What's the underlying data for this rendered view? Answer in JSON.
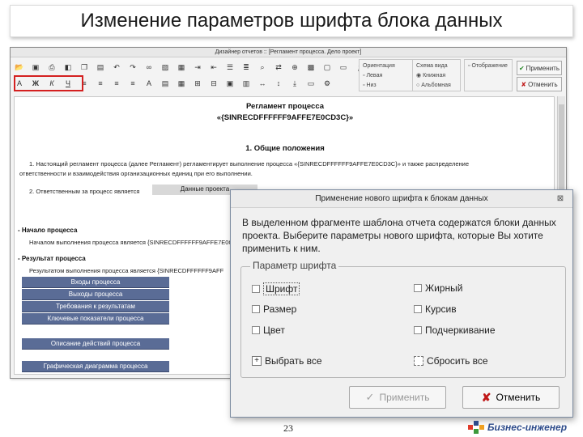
{
  "slide": {
    "title": "Изменение параметров шрифта блока данных",
    "page_number": "23",
    "brand": "Бизнес-инженер"
  },
  "editor": {
    "window_title": "Дизайнер отчетов :: [Регламент процесса. Дело проект]",
    "toolbar_row1_icons": [
      "open-icon",
      "save-icon",
      "print-icon",
      "preview-icon",
      "copy-icon",
      "paste-icon",
      "undo-icon",
      "redo-icon",
      "link-icon",
      "image-icon",
      "table-icon",
      "indent-icon",
      "outdent-icon",
      "list-icon",
      "numbered-list-icon",
      "find-icon",
      "replace-icon",
      "zoom-icon",
      "grid-icon",
      "frame-icon",
      "field-icon",
      "variable-icon"
    ],
    "toolbar_row2_fmt": [
      "А",
      "Ж",
      "К",
      "Ч"
    ],
    "groups": {
      "orientation": [
        "Ориентация",
        "Левая",
        "Низ"
      ],
      "scheme": [
        "Схема вида",
        "Книжная",
        "Альбомная"
      ],
      "display": [
        "Отображение"
      ]
    },
    "apply_label": "Применить",
    "cancel_label": "Отменить"
  },
  "document": {
    "title1": "Регламент процесса",
    "title2": "«{SINRECDFFFFFF9AFFE7E0CD3C}»",
    "section1": "1. Общие положения",
    "para1a": "1. Настоящий регламент процесса (далее Регламент) регламентирует выполнение процесса «{SINRECDFFFFFF9AFFE7E0CD3C}» и также распределение",
    "para1b": "ответственности и взаимодействия организационных единиц при его выполнении.",
    "para2": "2. Ответственным за процесс является",
    "data_field": "Данные проекта",
    "start_header": "- Начало процесса",
    "start_text": "Началом выполнения процесса является {SINRECDFFFFFF9AFFE7E0CD3C}",
    "result_header": "- Результат процесса",
    "result_text": "Результатом выполнения процесса является {SINRECDFFFFFF9AFF",
    "blocks": [
      "Входы процесса",
      "Выходы процесса",
      "Требования к результатам",
      "Ключевые показатели процесса"
    ],
    "block_actions": "Описание действий процесса",
    "block_diagram": "Графическая диаграмма процесса"
  },
  "dialog": {
    "title": "Применение нового шрифта к блокам данных",
    "message": "В выделенном фрагменте шаблона отчета содержатся блоки данных проекта. Выберите параметры нового шрифта, которые Вы хотите применить к ним.",
    "legend": "Параметр шрифта",
    "options": {
      "font": "Шрифт",
      "size": "Размер",
      "color": "Цвет",
      "bold": "Жирный",
      "italic": "Курсив",
      "underline": "Подчеркивание"
    },
    "select_all": "Выбрать все",
    "reset_all": "Сбросить все",
    "apply": "Применить",
    "cancel": "Отменить"
  },
  "colors": {
    "block_bar": "#5a6c96",
    "highlight": "#d42020",
    "brand": "#2c4a8a"
  }
}
